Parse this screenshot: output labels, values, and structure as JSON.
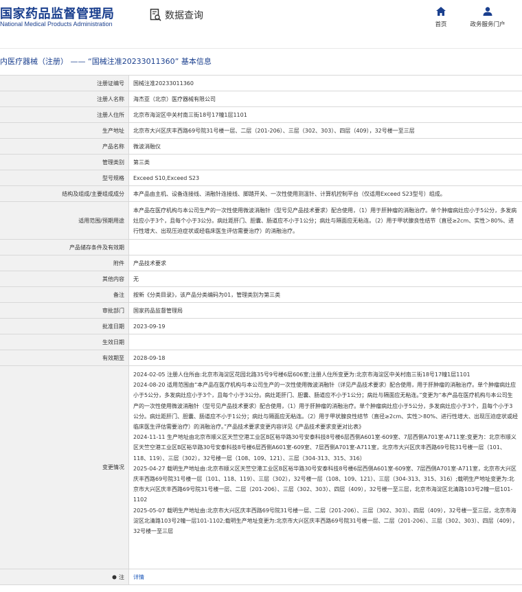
{
  "header": {
    "logo_cn": "国家药品监督管理局",
    "logo_en": "National Medical Products Administration",
    "data_query": "数据查询",
    "nav": [
      {
        "label": "首页",
        "icon": "home-icon"
      },
      {
        "label": "政务服务门户",
        "icon": "user-icon"
      }
    ]
  },
  "title": "内医疗器械（注册） —— “国械注准20233011360” 基本信息",
  "rows": [
    {
      "label": "注册证编号",
      "value": "国械注准20233011360"
    },
    {
      "label": "注册人名称",
      "value": "海杰亚（北京）医疗器械有限公司"
    },
    {
      "label": "注册人住所",
      "value": "北京市海淀区中关村南三街18号17幢1层1101"
    },
    {
      "label": "生产地址",
      "value": "北京市大兴区庆丰西路69号院31号楼一层、二层（201-206）、三层（302、303）、四层（409），32号楼一至三层"
    },
    {
      "label": "产品名称",
      "value": "微波消融仪"
    },
    {
      "label": "管理类别",
      "value": "第三类"
    },
    {
      "label": "型号规格",
      "value": "Exceed S10,Exceed S23"
    },
    {
      "label": "结构及组成/主要组成成分",
      "value": "本产品由主机、设备连接线、消融针连接线、脚踏开关、一次性使用测温针、计算机控制平台（仅适用Exceed S23型号）组成。"
    },
    {
      "label": "适用范围/预期用途",
      "value": "本产品在医疗机构与本公司生产的一次性使用微波消融针（型号见产品技术要求）配合使用，（1）用于肝肿瘤的消融治疗。单个肿瘤病灶应小于5公分，多发病灶应小于3个，且每个小于3公分。病灶距肝门、胆囊、肠道应不小于1公分；病灶与隔面应无粘连。（2）用于甲状腺良性结节（直径≥2cm、实性＞80%、进行性增大、出现压迫症状或经临床医生评估需要治疗）的消融治疗。"
    },
    {
      "label": "产品储存条件及有效期",
      "value": ""
    },
    {
      "label": "附件",
      "value": "产品技术要求"
    },
    {
      "label": "其他内容",
      "value": "无"
    },
    {
      "label": "备注",
      "value": "按新《分类目录》，该产品分类编码为01，管理类别为第三类"
    },
    {
      "label": "审批部门",
      "value": "国家药品监督管理局"
    },
    {
      "label": "批准日期",
      "value": "2023-09-19"
    },
    {
      "label": "生效日期",
      "value": ""
    },
    {
      "label": "有效期至",
      "value": "2028-09-18"
    }
  ],
  "changes": {
    "label": "变更情况",
    "entries": [
      "2024-02-05 注册人住所由:北京市海淀区花园北路35号9号楼6层606室;注册人住所变更为:北京市海淀区中关村南三街18号17幢1层1101",
      "2024-08-20 适用范围由“本产品在医疗机构与本公司生产的一次性使用微波消融针（详见产品技术要求）配合使用，用于肝肿瘤的消融治疗。单个肿瘤病灶应小于5公分，多发病灶应小于3个，且每个小于3公分。病灶距肝门、胆囊、肠道应不小于1公分；病灶与隔面应无粘连。”变更为“本产品在医疗机构与本公司生产的一次性使用微波消融针（型号见产品技术要求）配合使用，（1）用于肝肿瘤的消融治疗。单个肿瘤病灶应小于5公分，多发病灶应小于3个，且每个小于3公分。病灶距肝门、胆囊、肠道应不小于1公分；病灶与隔面应无粘连。（2）用于甲状腺良性结节（直径≥2cm、实性＞80%、进行性增大、出现压迫症状或经临床医生评估需要治疗）的消融治疗。”产品技术要求变更内容详见《产品技术要求变更对比表》",
      "2024-11-11 生产地址由北京市顺义区天竺空港工业区B区裕华路30号安泰科技8号楼6层西侧A601室-609室、7层西侧A701室-A711室;变更为：北京市顺义区天竺空港工业区B区裕华路30号安泰科技8号楼6层西侧A601室-609室、7层西侧A701室-A711室，北京市大兴区庆丰西路69号院31号楼一层（101、118、119）、三层（302），32号楼一层（108、109、121）、三层（304-313、315、316）",
      "2025-04-27 载明生产地址由:北京市顺义区天竺空港工业区B区裕华路30号安泰科技8号楼6层西侧A601室-609室、7层西侧A701室-A711室，北京市大兴区庆丰西路69号院31号楼一层（101、118、119）、三层（302），32号楼一层（108、109、121）、三层（304-313、315、316）;载明生产地址变更为:北京市大兴区庆丰西路69号院31号楼一层、二层（201-206）、三层（302、303）、四层（409），32号楼一至三层，北京市海淀区北清路103号2幢一层101-1102",
      "2025-05-07 载明生产地址由:北京市大兴区庆丰西路69号院31号楼一层、二层（201-206）、三层（302、303）、四层（409），32号楼一至三层，北京市海淀区北清路103号2幢一层101-1102;载明生产地址变更为:北京市大兴区庆丰西路69号院31号楼一层、二层（201-206）、三层（302、303）、四层（409），32号楼一至三层"
    ]
  },
  "note": {
    "label": "注",
    "icon": "bullet-icon",
    "value": "详情"
  }
}
